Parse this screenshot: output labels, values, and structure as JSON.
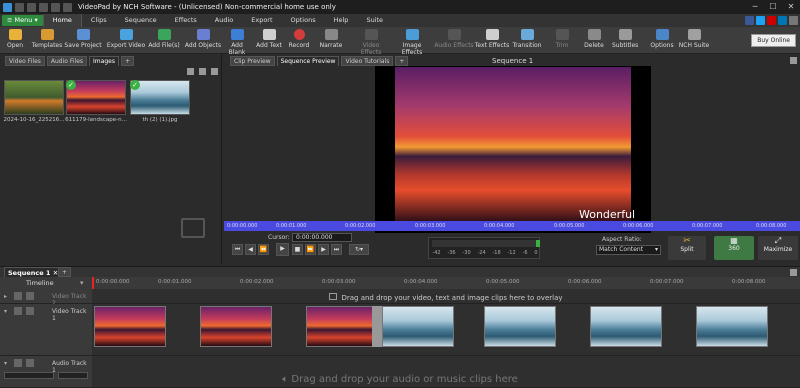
{
  "app": {
    "title": "VideoPad by NCH Software - (Unlicensed) Non-commercial home use only"
  },
  "menu": {
    "menu_button": "Menu",
    "tabs": [
      "Home",
      "Clips",
      "Sequence",
      "Effects",
      "Audio",
      "Export",
      "Options",
      "Help",
      "Suite"
    ]
  },
  "toolbar": {
    "items": [
      "Open",
      "Templates",
      "Save Project",
      "Export Video",
      "Add File(s)",
      "Add Objects",
      "Add Blank",
      "Add Text",
      "Record",
      "Narrate",
      "Video Effects",
      "Image Effects",
      "Audio Effects",
      "Text Effects",
      "Transition",
      "Trim",
      "Delete",
      "Subtitles",
      "Options",
      "NCH Suite"
    ],
    "buy_online": "Buy Online"
  },
  "bin": {
    "tabs": [
      "Video Files",
      "Audio Files",
      "Images",
      "+"
    ],
    "files": [
      {
        "label": "2024-10-16_225216...",
        "checked": false
      },
      {
        "label": "611179-landscape-n...",
        "checked": true
      },
      {
        "label": "th (2) (1).jpg",
        "checked": true
      }
    ]
  },
  "preview": {
    "tabs": [
      "Clip Preview",
      "Sequence Preview",
      "Video Tutorials",
      "+"
    ],
    "sequence_title": "Sequence 1",
    "overlay_text": "Wonderful",
    "ruler_ticks": [
      "0:00:00.000",
      "0:00:01.000",
      "0:00:02.000",
      "0:00:03.000",
      "0:00:04.000",
      "0:00:05.000",
      "0:00:06.000",
      "0:00:07.000",
      "0:00:08.000"
    ],
    "cursor_label": "Cursor:",
    "cursor_value": "0:00:00.000",
    "meter_labels": [
      "-42",
      "-36",
      "-30",
      "-24",
      "-18",
      "-12",
      "-6",
      "0"
    ],
    "aspect_label": "Aspect Ratio:",
    "aspect_value": "Match Content",
    "split": "Split",
    "three_sixty": "360",
    "maximize": "Maximize"
  },
  "timeline": {
    "seq_tab": "Sequence 1",
    "timeline_label": "Timeline",
    "ruler_ticks": [
      "0:00:00.000",
      "0:00:01.000",
      "0:00:02.000",
      "0:00:03.000",
      "0:00:04.000",
      "0:00:05.000",
      "0:00:06.000",
      "0:00:07.000",
      "0:00:08.000"
    ],
    "video_track_2": "Video Track 2",
    "video_track_1": "Video Track 1",
    "audio_track_1": "Audio Track 1",
    "overlay_drop": "Drag and drop your video, text and image clips here to overlay",
    "audio_drop": "Drag and drop your audio or music clips here"
  }
}
